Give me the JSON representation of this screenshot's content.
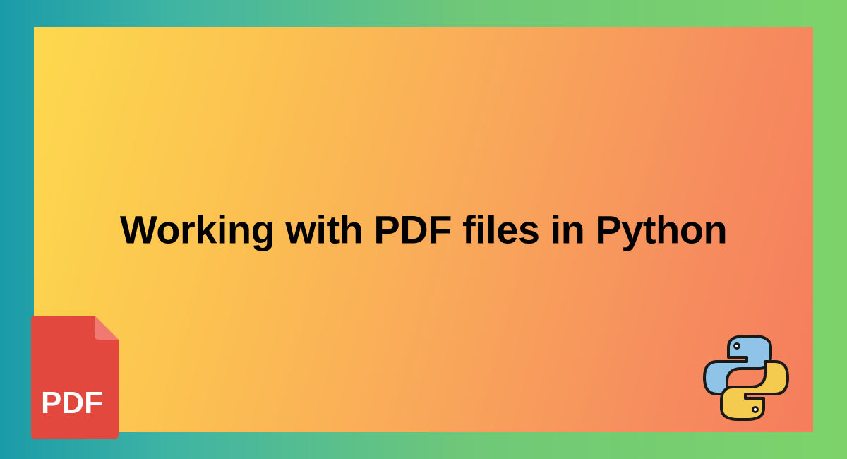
{
  "title": "Working with PDF files in Python",
  "pdf_label": "PDF"
}
